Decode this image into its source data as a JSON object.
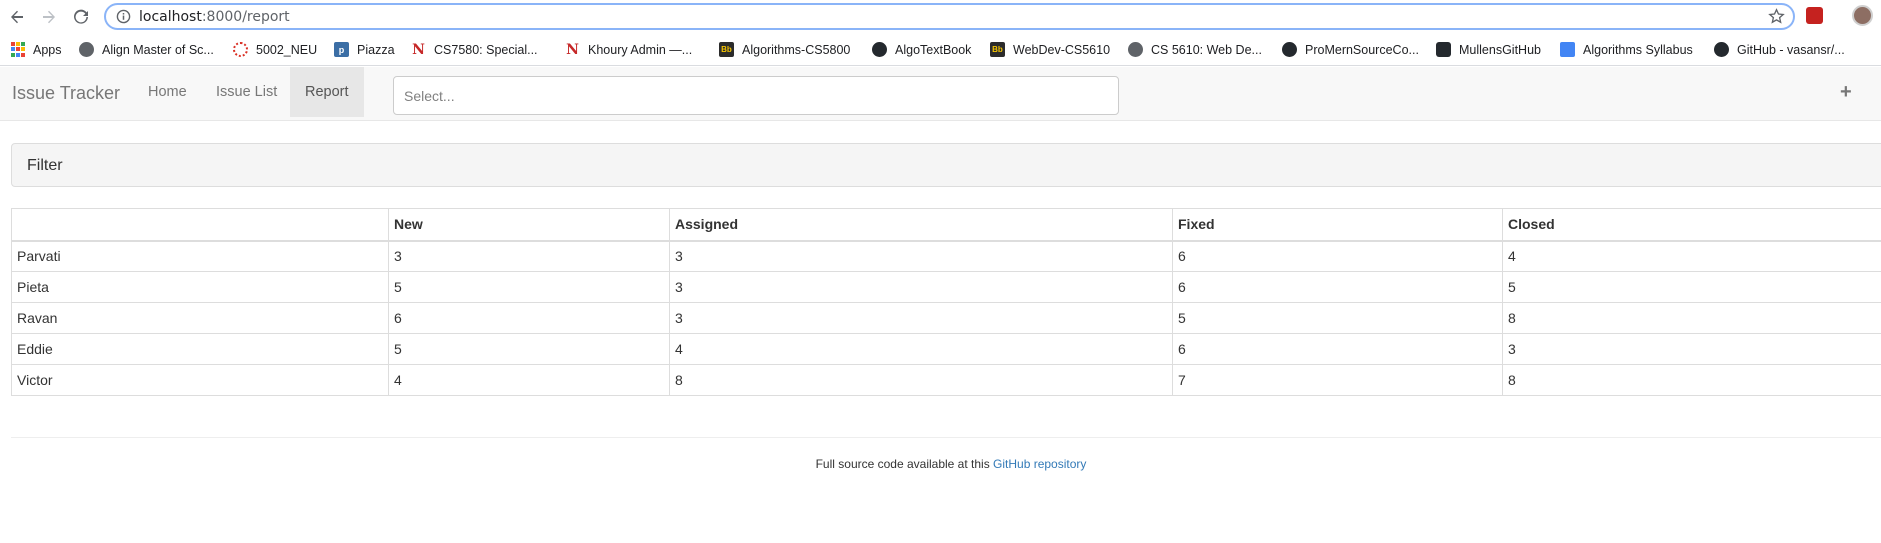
{
  "browser": {
    "url_host": "localhost",
    "url_path": ":8000/report",
    "bookmarks": [
      {
        "label": "Apps",
        "icon": "apps-grid-icon"
      },
      {
        "label": "Align Master of Sc...",
        "icon": "globe-icon"
      },
      {
        "label": "5002_NEU",
        "icon": "ring-icon"
      },
      {
        "label": "Piazza",
        "icon": "piazza-icon"
      },
      {
        "label": "CS7580: Special...",
        "icon": "northeastern-icon"
      },
      {
        "label": "Khoury Admin —...",
        "icon": "northeastern-icon"
      },
      {
        "label": "Algorithms-CS5800",
        "icon": "blackboard-icon"
      },
      {
        "label": "AlgoTextBook",
        "icon": "github-icon"
      },
      {
        "label": "WebDev-CS5610",
        "icon": "blackboard-icon"
      },
      {
        "label": "CS 5610: Web De...",
        "icon": "globe-icon"
      },
      {
        "label": "ProMernSourceCo...",
        "icon": "github-icon"
      },
      {
        "label": "MullensGitHub",
        "icon": "github-icon"
      },
      {
        "label": "Algorithms Syllabus",
        "icon": "google-docs-icon"
      },
      {
        "label": "GitHub - vasansr/...",
        "icon": "github-icon"
      }
    ]
  },
  "navbar": {
    "brand": "Issue Tracker",
    "links": [
      "Home",
      "Issue List",
      "Report"
    ],
    "active": "Report",
    "select_placeholder": "Select...",
    "add_icon": "plus-icon"
  },
  "filter": {
    "title": "Filter"
  },
  "report": {
    "columns": [
      "",
      "New",
      "Assigned",
      "Fixed",
      "Closed"
    ],
    "rows": [
      {
        "owner": "Parvati",
        "new": "3",
        "assigned": "3",
        "fixed": "6",
        "closed": "4"
      },
      {
        "owner": "Pieta",
        "new": "5",
        "assigned": "3",
        "fixed": "6",
        "closed": "5"
      },
      {
        "owner": "Ravan",
        "new": "6",
        "assigned": "3",
        "fixed": "5",
        "closed": "8"
      },
      {
        "owner": "Eddie",
        "new": "5",
        "assigned": "4",
        "fixed": "6",
        "closed": "3"
      },
      {
        "owner": "Victor",
        "new": "4",
        "assigned": "8",
        "fixed": "7",
        "closed": "8"
      }
    ]
  },
  "footer": {
    "text": "Full source code available at this",
    "link": "GitHub repository"
  },
  "colors": {
    "link": "#337ab7",
    "navbar_bg": "#f8f8f8",
    "active_nav_bg": "#e7e7e7",
    "omnibox_focus": "#8ab4f8"
  }
}
